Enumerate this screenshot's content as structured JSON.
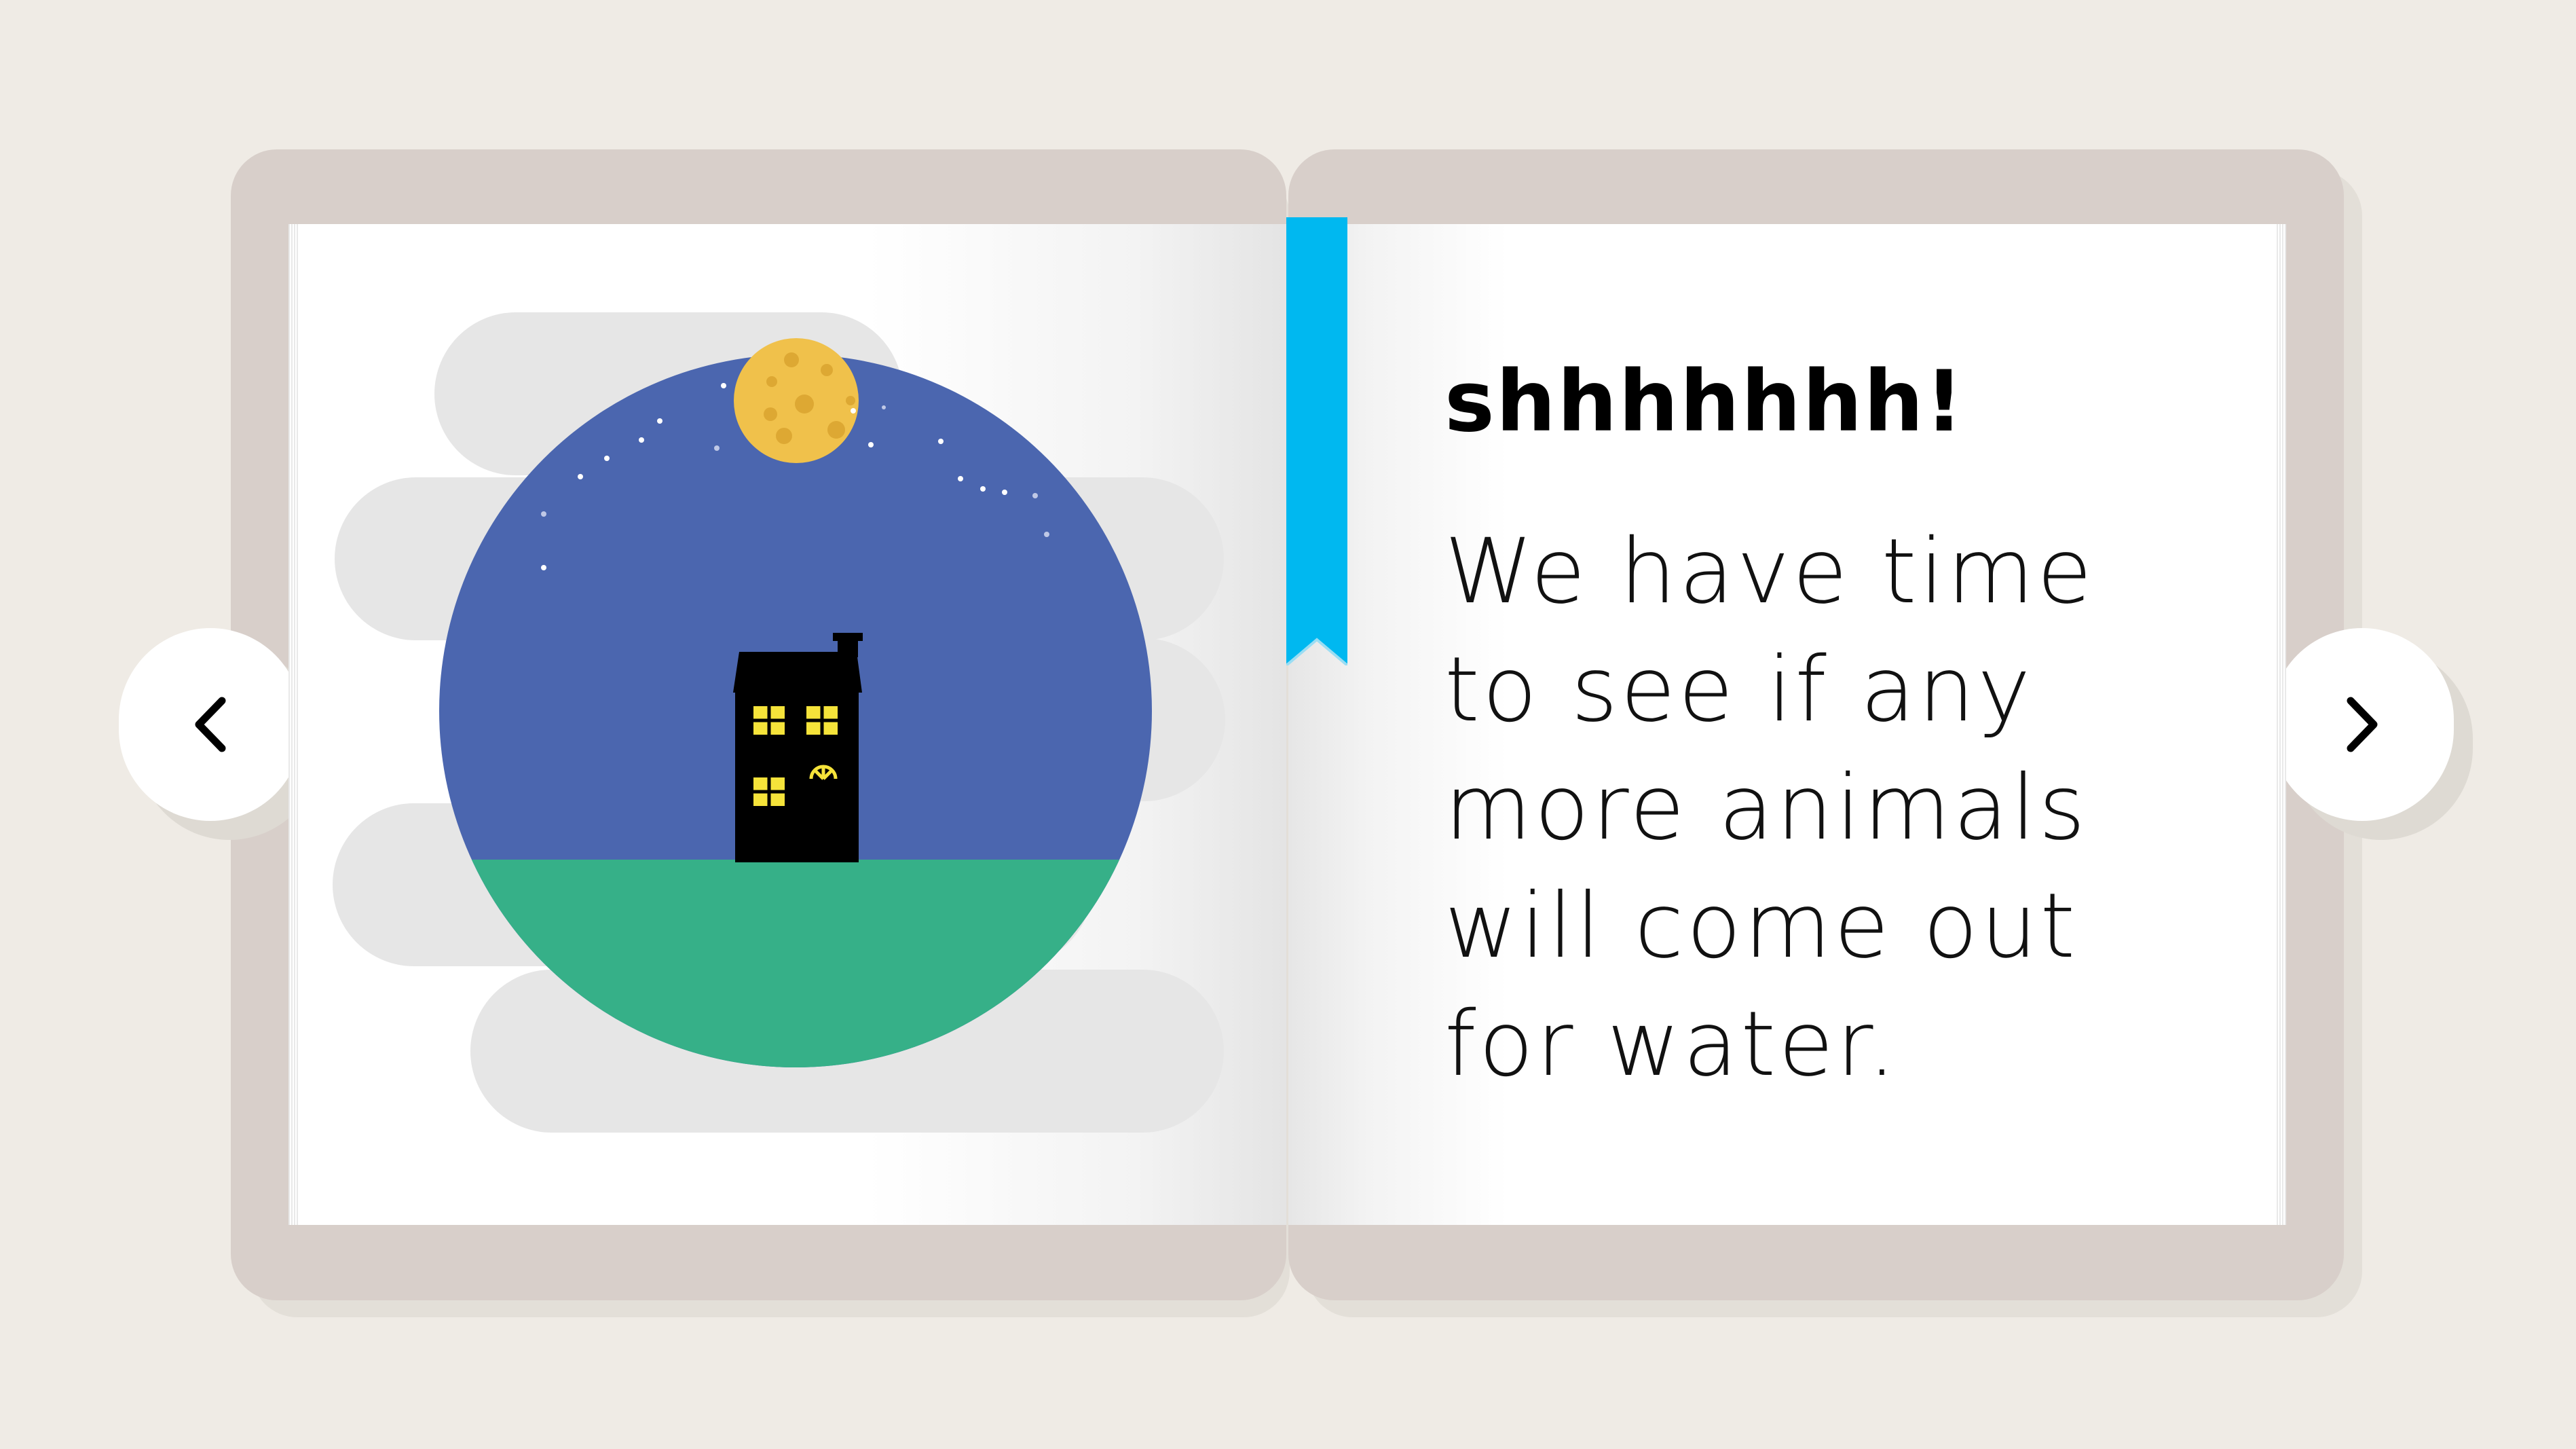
{
  "navigation": {
    "prev_icon": "chevron-left-icon",
    "next_icon": "chevron-right-icon"
  },
  "page_text": {
    "title": "shhhhhhh!",
    "lines": [
      "We have time",
      "to see if any",
      "more animals",
      "will come out",
      "for water."
    ]
  },
  "colors": {
    "background": "#EFEBE5",
    "cover": "#D8CFCA",
    "sky": "#4B66AF",
    "grass": "#36B088",
    "moon": "#F0C14B",
    "bookmark": "#00B8F0",
    "window_light": "#F5E33A"
  },
  "illustration": {
    "icons": [
      "moon-icon",
      "house-icon",
      "star-icon"
    ]
  }
}
